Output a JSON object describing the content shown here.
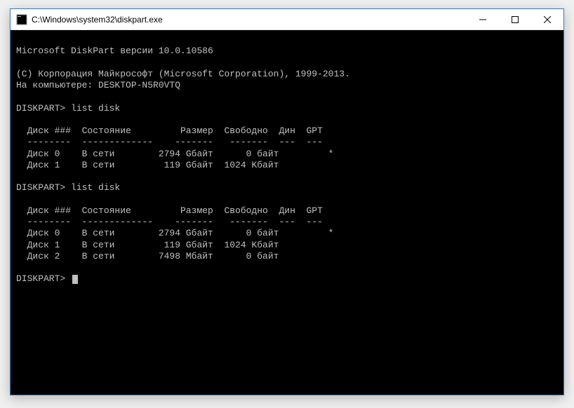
{
  "window": {
    "title": "C:\\Windows\\system32\\diskpart.exe"
  },
  "console": {
    "header_line": "Microsoft DiskPart версии 10.0.10586",
    "copyright": "(C) Корпорация Майкрософт (Microsoft Corporation), 1999-2013.",
    "computer": "На компьютере: DESKTOP-N5R0VTQ",
    "prompt": "DISKPART>",
    "command": "list disk",
    "headers": {
      "disk": "Диск ###",
      "state": "Состояние",
      "size": "Размер",
      "free": "Свободно",
      "dyn": "Дин",
      "gpt": "GPT"
    },
    "dashes": {
      "disk": "--------",
      "state": "-------------",
      "size": "-------",
      "free": "-------",
      "dyn": "---",
      "gpt": "---"
    },
    "rows1": [
      {
        "disk": "Диск 0",
        "state": "В сети",
        "size": "2794 Gбайт",
        "free": "0 байт",
        "dyn": "",
        "gpt": "*"
      },
      {
        "disk": "Диск 1",
        "state": "В сети",
        "size": "119 Gбайт",
        "free": "1024 Kбайт",
        "dyn": "",
        "gpt": ""
      }
    ],
    "rows2": [
      {
        "disk": "Диск 0",
        "state": "В сети",
        "size": "2794 Gбайт",
        "free": "0 байт",
        "dyn": "",
        "gpt": "*"
      },
      {
        "disk": "Диск 1",
        "state": "В сети",
        "size": "119 Gбайт",
        "free": "1024 Kбайт",
        "dyn": "",
        "gpt": ""
      },
      {
        "disk": "Диск 2",
        "state": "В сети",
        "size": "7498 Mбайт",
        "free": "0 байт",
        "dyn": "",
        "gpt": ""
      }
    ]
  }
}
